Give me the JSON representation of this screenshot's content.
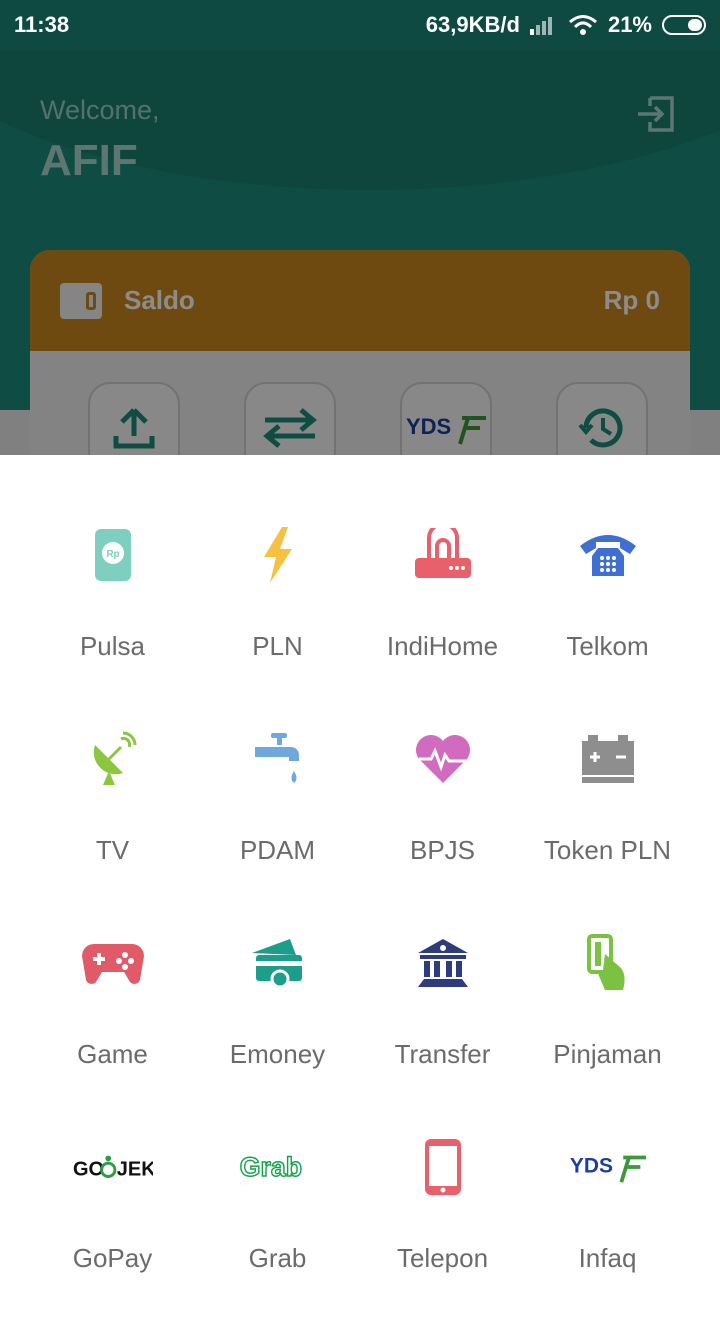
{
  "status_bar": {
    "time": "11:38",
    "network_speed": "63,9KB/d",
    "battery": "21%"
  },
  "header": {
    "welcome": "Welcome,",
    "username": "AFIF",
    "logout_icon": "logout-icon"
  },
  "saldo": {
    "label": "Saldo",
    "amount": "Rp 0"
  },
  "quick_actions": [
    {
      "icon": "upload-icon"
    },
    {
      "icon": "transfer-arrows-icon"
    },
    {
      "icon": "ydsf-logo-icon"
    },
    {
      "icon": "history-icon"
    }
  ],
  "menu": [
    {
      "label": "Pulsa",
      "icon": "phone-rp-icon"
    },
    {
      "label": "PLN",
      "icon": "lightning-icon"
    },
    {
      "label": "IndiHome",
      "icon": "router-icon"
    },
    {
      "label": "Telkom",
      "icon": "telephone-icon"
    },
    {
      "label": "TV",
      "icon": "satellite-dish-icon"
    },
    {
      "label": "PDAM",
      "icon": "water-tap-icon"
    },
    {
      "label": "BPJS",
      "icon": "heartbeat-icon"
    },
    {
      "label": "Token PLN",
      "icon": "battery-token-icon"
    },
    {
      "label": "Game",
      "icon": "gamepad-icon"
    },
    {
      "label": "Emoney",
      "icon": "emoney-card-icon"
    },
    {
      "label": "Transfer",
      "icon": "bank-icon"
    },
    {
      "label": "Pinjaman",
      "icon": "hand-card-icon"
    },
    {
      "label": "GoPay",
      "icon": "gojek-logo-icon",
      "logo_text": "GO JEK"
    },
    {
      "label": "Grab",
      "icon": "grab-logo-icon",
      "logo_text": "Grab"
    },
    {
      "label": "Telepon",
      "icon": "smartphone-icon"
    },
    {
      "label": "Infaq",
      "icon": "ydsf-logo-icon",
      "logo_text": "YDSF"
    }
  ],
  "colors": {
    "header_green": "#1d8a7a",
    "saldo_orange": "#c8861e",
    "label_gray": "#6b6b6b"
  }
}
